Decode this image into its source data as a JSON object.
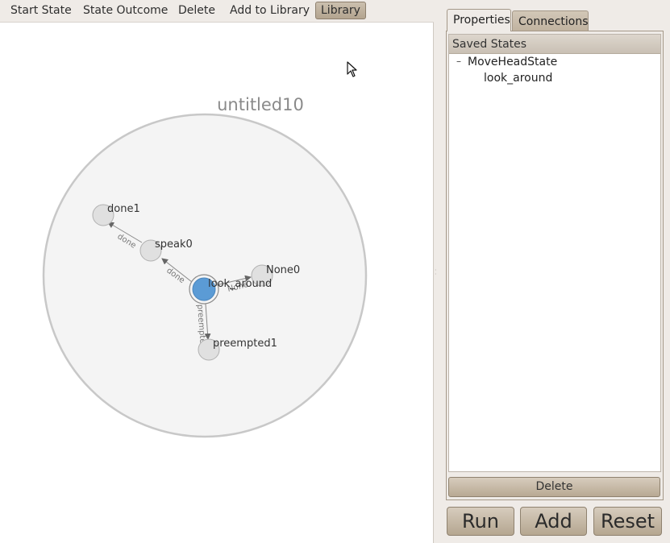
{
  "toolbar": {
    "buttons": [
      "Start State",
      "State Outcome",
      "Delete",
      "Add to Library",
      "Library"
    ],
    "active": "Library"
  },
  "canvas": {
    "container_label": "untitled10",
    "nodes": {
      "done1": "done1",
      "speak0": "speak0",
      "look_around": "look_around",
      "none0": "None0",
      "preempted1": "preempted1"
    },
    "edges": {
      "speak_done": "done",
      "look_done": "done",
      "look_none": "None",
      "look_preempted": "preempted"
    }
  },
  "panel": {
    "tabs": [
      "Properties",
      "Connections"
    ],
    "selected_tab": "Properties",
    "tree": {
      "header": "Saved States",
      "expander": "–",
      "root": "MoveHeadState",
      "child": "look_around"
    },
    "delete_label": "Delete"
  },
  "actions": {
    "run": "Run",
    "add": "Add",
    "reset": "Reset"
  },
  "colors": {
    "active_state": "#5b9bd5",
    "state_fill": "#e0e0e0",
    "container_fill": "#f4f4f4"
  }
}
